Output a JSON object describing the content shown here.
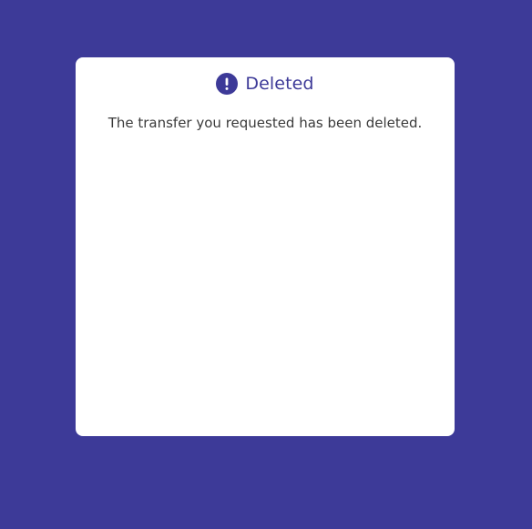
{
  "colors": {
    "background": "#3d3a98",
    "card": "#ffffff",
    "accent": "#3d3a98",
    "body_text": "#3a3a3a"
  },
  "dialog": {
    "icon": "alert-circle-icon",
    "title": "Deleted",
    "message": "The transfer you requested has been deleted."
  }
}
